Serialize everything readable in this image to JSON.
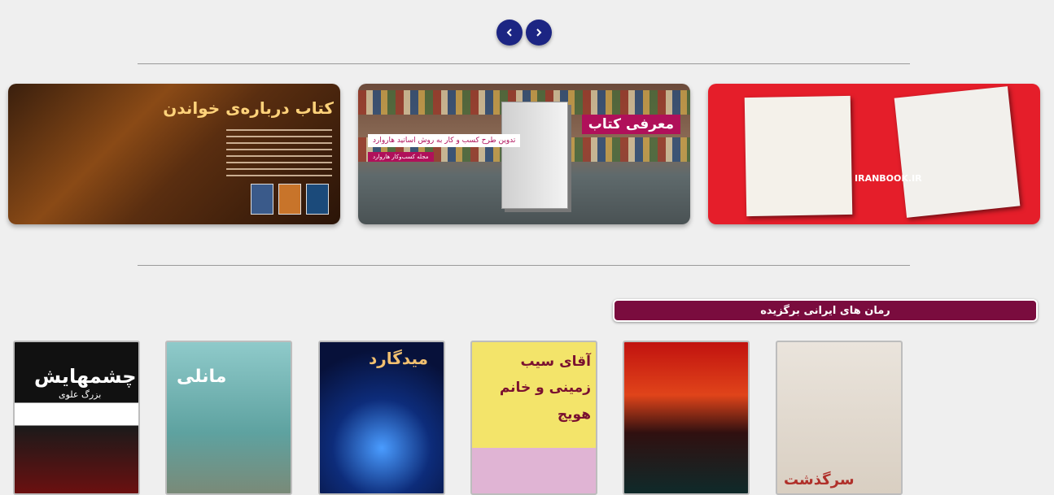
{
  "carousel": {
    "prev_label": "previous",
    "next_label": "next"
  },
  "banners": [
    {
      "title": "کتاب درباره‌ی خواندن"
    },
    {
      "tag": "معرفی کتاب",
      "subtitle": "تدوین طرح کسب و کار به روش اساتید هاروارد",
      "caption": "مجله کسب‌وکار هاروارد"
    },
    {
      "logo_text": "IRANBOOK.IR"
    }
  ],
  "section": {
    "title": "رمان های ایرانی برگزیده"
  },
  "books": [
    {
      "title": "چشمهایش",
      "author": "بزرگ علوی"
    },
    {
      "title": "مانلی",
      "author": ""
    },
    {
      "title": "میدگارد",
      "author": ""
    },
    {
      "title": "آقای سیب زمینی و خانم هویج",
      "author": ""
    },
    {
      "title": "",
      "author": ""
    },
    {
      "title": "سرگذشت",
      "author": ""
    }
  ]
}
